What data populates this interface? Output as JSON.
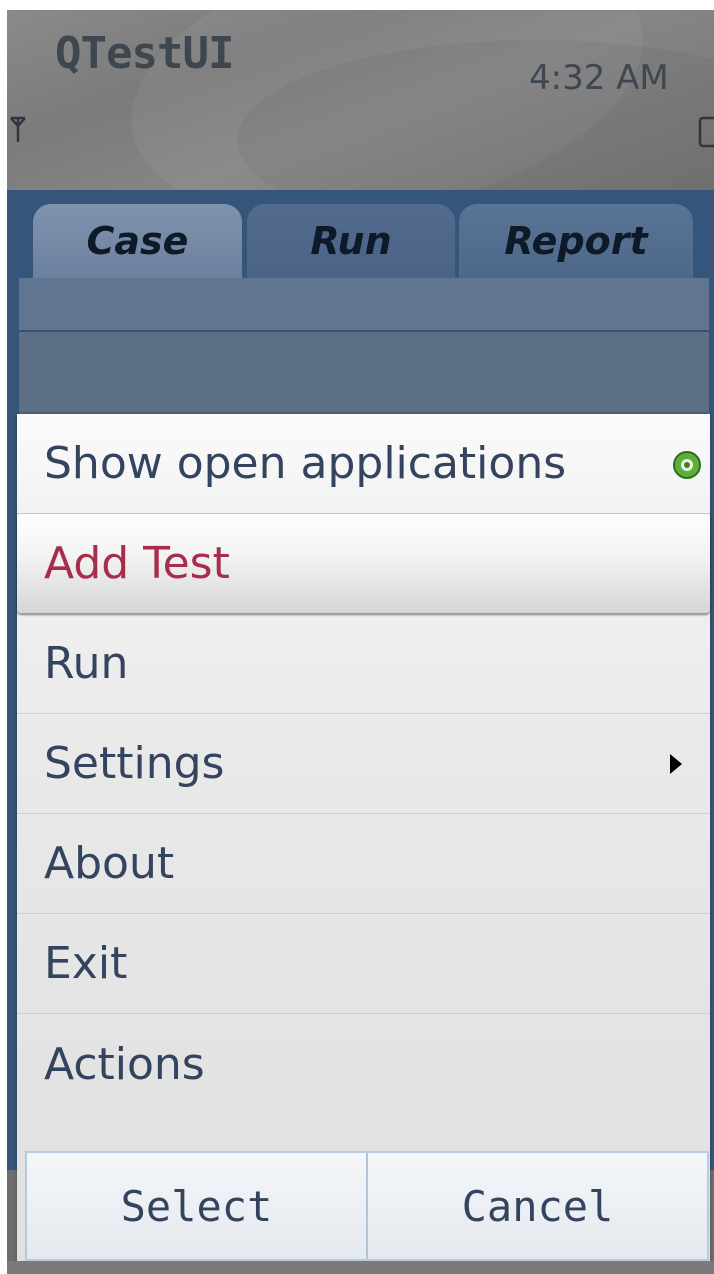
{
  "status_pane": {
    "app_title": "QTestUI",
    "clock": "4:32 AM",
    "signal_icon": "signal-antenna-icon",
    "battery_icon": "battery-icon"
  },
  "tabs": [
    {
      "label": "Case",
      "active": true
    },
    {
      "label": "Run",
      "active": false
    },
    {
      "label": "Report",
      "active": false
    }
  ],
  "options_menu": {
    "items": [
      {
        "label": "Show open applications",
        "icon": "active-indicator-icon",
        "highlighted": false
      },
      {
        "label": "Add Test",
        "highlighted": true
      },
      {
        "label": "Run",
        "highlighted": false
      },
      {
        "label": "Settings",
        "icon": "submenu-arrow-icon",
        "highlighted": false
      },
      {
        "label": "About",
        "highlighted": false
      },
      {
        "label": "Exit",
        "highlighted": false
      },
      {
        "label": "Actions",
        "highlighted": false
      }
    ]
  },
  "softkeys": {
    "left": "Select",
    "right": "Cancel"
  },
  "colors": {
    "highlight_text": "#a62d4b",
    "menu_text": "#34445e",
    "background_blue": "#36557a",
    "indicator_green": "#5cb03a"
  }
}
